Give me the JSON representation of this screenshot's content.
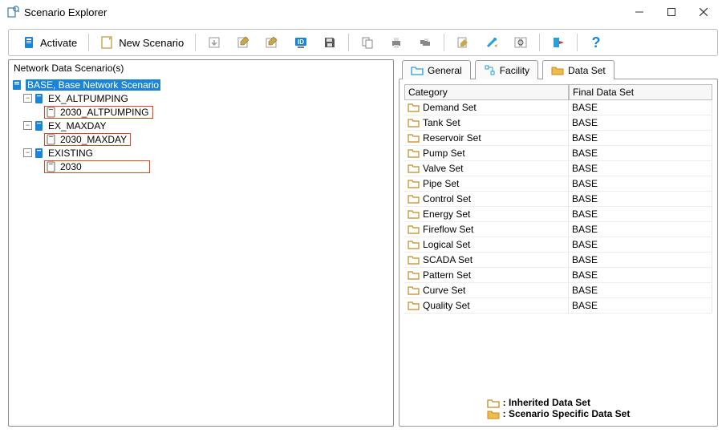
{
  "window": {
    "title": "Scenario Explorer"
  },
  "toolbar": {
    "activate_label": "Activate",
    "new_scenario_label": "New Scenario"
  },
  "left": {
    "header": "Network Data Scenario(s)",
    "tree": {
      "root": "BASE, Base Network Scenario",
      "n1": "EX_ALTPUMPING",
      "n1a": "2030_ALTPUMPING",
      "n2": "EX_MAXDAY",
      "n2a": "2030_MAXDAY",
      "n3": "EXISTING",
      "n3a": "2030"
    }
  },
  "tabs": {
    "general": "General",
    "facility": "Facility",
    "dataset": "Data Set"
  },
  "grid": {
    "header_category": "Category",
    "header_value": "Final Data Set",
    "rows": [
      {
        "category": "Demand Set",
        "value": "BASE"
      },
      {
        "category": "Tank Set",
        "value": "BASE"
      },
      {
        "category": "Reservoir Set",
        "value": "BASE"
      },
      {
        "category": "Pump Set",
        "value": "BASE"
      },
      {
        "category": "Valve Set",
        "value": "BASE"
      },
      {
        "category": "Pipe Set",
        "value": "BASE"
      },
      {
        "category": "Control Set",
        "value": "BASE"
      },
      {
        "category": "Energy Set",
        "value": "BASE"
      },
      {
        "category": "Fireflow Set",
        "value": "BASE"
      },
      {
        "category": "Logical Set",
        "value": "BASE"
      },
      {
        "category": "SCADA Set",
        "value": "BASE"
      },
      {
        "category": "Pattern Set",
        "value": "BASE"
      },
      {
        "category": "Curve Set",
        "value": "BASE"
      },
      {
        "category": "Quality Set",
        "value": "BASE"
      }
    ]
  },
  "legend": {
    "inherited": ": Inherited Data Set",
    "specific": ": Scenario Specific Data Set"
  }
}
